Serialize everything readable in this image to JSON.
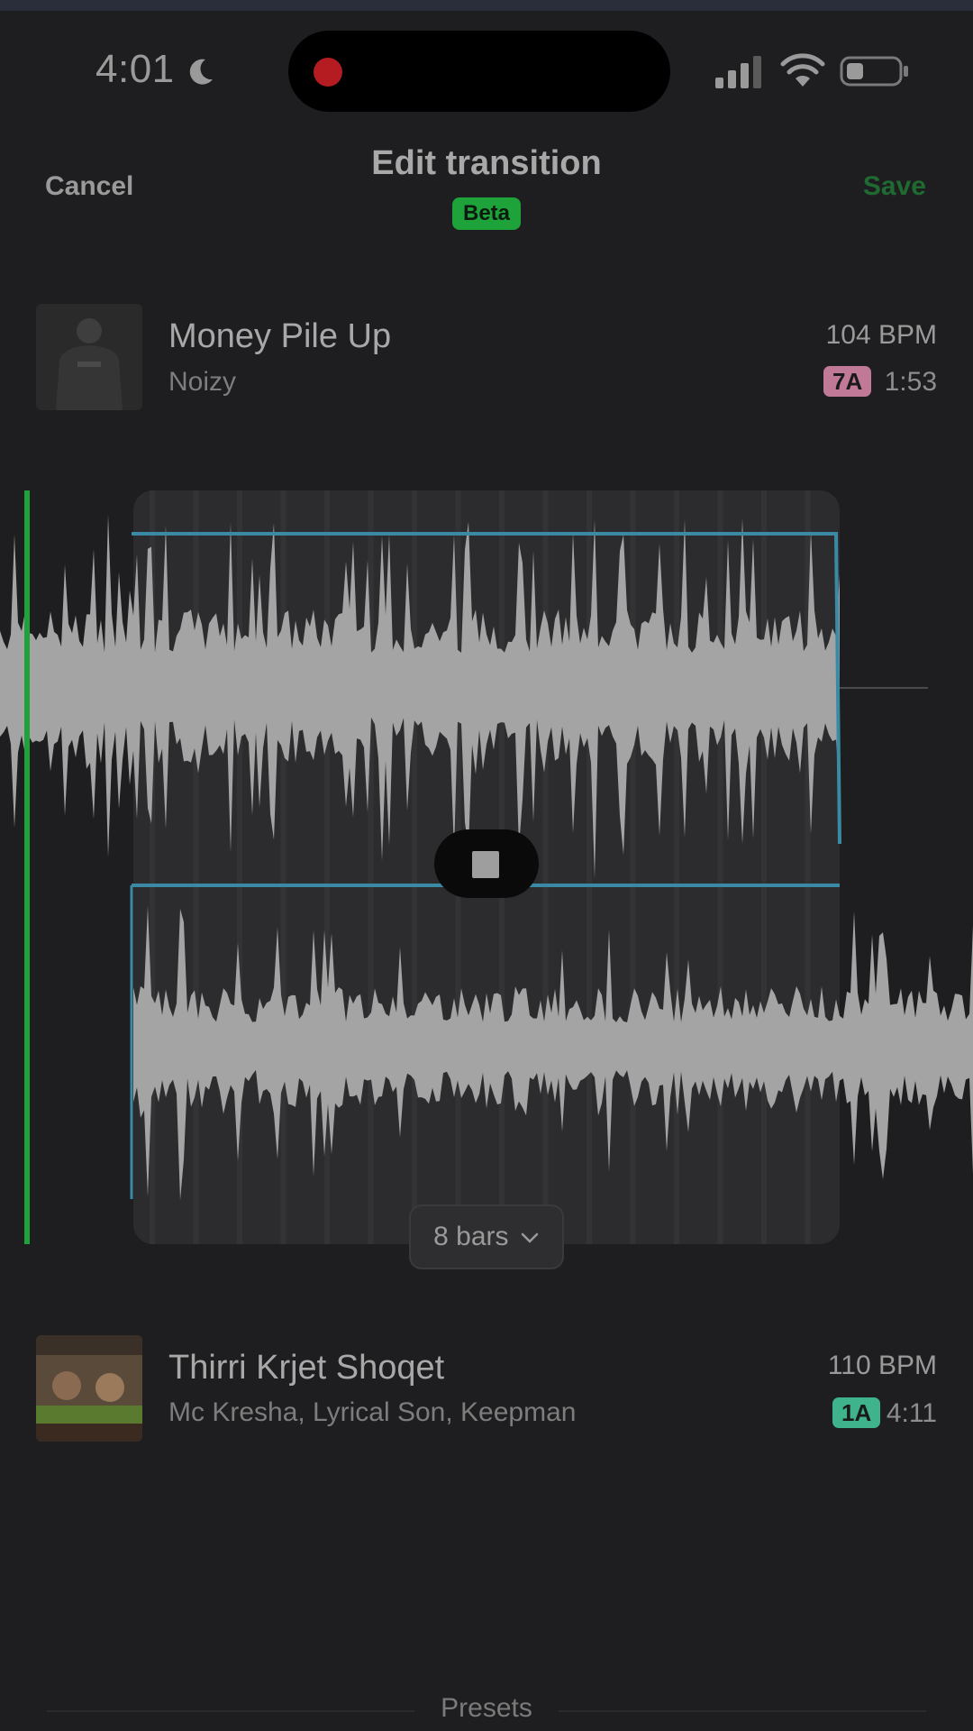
{
  "status_bar": {
    "time": "4:01"
  },
  "header": {
    "cancel": "Cancel",
    "title": "Edit transition",
    "beta": "Beta",
    "save": "Save"
  },
  "track_a": {
    "title": "Money Pile Up",
    "artist": "Noizy",
    "bpm": "104 BPM",
    "key": "7A",
    "duration": "1:53"
  },
  "track_b": {
    "title": "Thirri Krjet Shoqet",
    "artist": "Mc Kresha, Lyrical Son, Keepman",
    "bpm": "110 BPM",
    "key": "1A",
    "duration": "4:11"
  },
  "transition": {
    "length_label": "8 bars"
  },
  "presets_label": "Presets",
  "colors": {
    "accent_green": "#1ea33a",
    "key_a": "#c07a98",
    "key_b": "#3fb38c",
    "transition_line": "#3a8aa6"
  }
}
